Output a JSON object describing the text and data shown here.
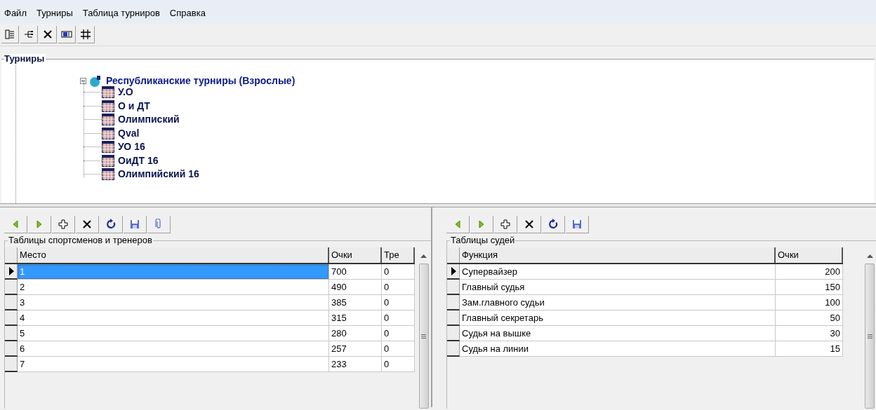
{
  "menu": [
    {
      "label": "Файл"
    },
    {
      "label": "Турниры"
    },
    {
      "label": "Таблица турниров"
    },
    {
      "label": "Справка"
    }
  ],
  "tree": {
    "title": "Турниры",
    "root": {
      "label": "Республиканские турниры (Взрослые)",
      "expanded": true,
      "children": [
        {
          "label": "У.О"
        },
        {
          "label": "О и ДТ"
        },
        {
          "label": "Олимпиский"
        },
        {
          "label": "Qval"
        },
        {
          "label": "УО 16"
        },
        {
          "label": "ОиДТ 16"
        },
        {
          "label": "Олимпийский 16"
        }
      ]
    }
  },
  "athletes": {
    "title": "Таблицы спортсменов и тренеров",
    "focused": true,
    "columns": [
      "Место",
      "Очки",
      "Тре"
    ],
    "rows": [
      {
        "cells": [
          "1",
          "700",
          "0"
        ],
        "selected": true
      },
      {
        "cells": [
          "2",
          "490",
          "0"
        ],
        "selected": false
      },
      {
        "cells": [
          "3",
          "385",
          "0"
        ],
        "selected": false
      },
      {
        "cells": [
          "4",
          "315",
          "0"
        ],
        "selected": false
      },
      {
        "cells": [
          "5",
          "280",
          "0"
        ],
        "selected": false
      },
      {
        "cells": [
          "6",
          "257",
          "0"
        ],
        "selected": false
      },
      {
        "cells": [
          "7",
          "233",
          "0"
        ],
        "selected": false
      }
    ]
  },
  "judges": {
    "title": "Таблицы судей",
    "focused": false,
    "columns": [
      "Функция",
      "Очки"
    ],
    "rows": [
      {
        "cells": [
          "Супервайзер",
          "200"
        ],
        "selected": true
      },
      {
        "cells": [
          "Главный судья",
          "150"
        ],
        "selected": false
      },
      {
        "cells": [
          "Зам.главного судьи",
          "100"
        ],
        "selected": false
      },
      {
        "cells": [
          "Главный секретарь",
          "50"
        ],
        "selected": false
      },
      {
        "cells": [
          "Судья на вышке",
          "30"
        ],
        "selected": false
      },
      {
        "cells": [
          "Судья на линии",
          "15"
        ],
        "selected": false
      }
    ]
  }
}
